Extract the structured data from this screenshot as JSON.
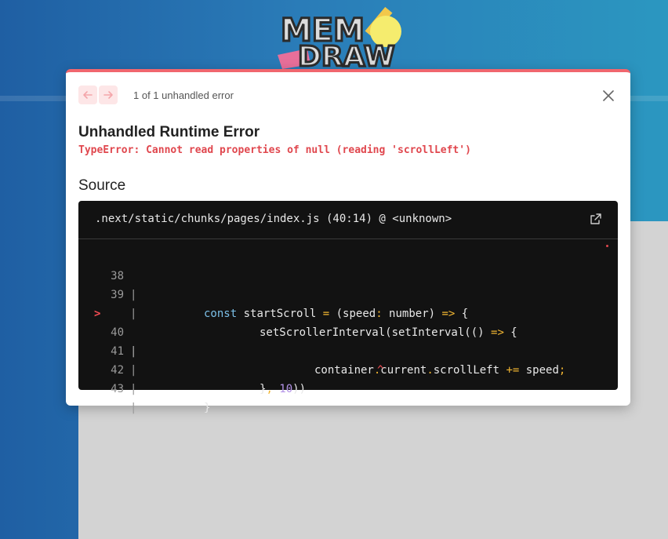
{
  "app": {
    "logo_line1": "MEM",
    "logo_line2": "DRAW"
  },
  "overlay": {
    "counter": "1 of 1 unhandled error",
    "title": "Unhandled Runtime Error",
    "message": "TypeError: Cannot read properties of null (reading 'scrollLeft')",
    "source_heading": "Source",
    "file_path": ".next/static/chunks/pages/index.js (40:14) @ <unknown>"
  },
  "code": {
    "marker": ">",
    "pipe": "|",
    "line_numbers": [
      "38",
      "39",
      "40",
      "",
      "41",
      "42",
      "43"
    ],
    "lines": [
      {
        "t1": "const",
        "t2": " startScroll ",
        "t3": "=",
        "t4": " (speed",
        "t5": ":",
        "t6": " number) ",
        "t7": "=>",
        "t8": " {"
      },
      {
        "t1": "setScrollerInterval(setInterval(() ",
        "t2": "=>",
        "t3": " {"
      },
      {
        "t1": "container",
        "t2": ".",
        "t3": "current",
        "t4": ".",
        "t5": "scrollLeft ",
        "t6": "+=",
        "t7": " speed",
        "t8": ";"
      },
      {
        "t1": "^"
      },
      {
        "t1": "}",
        "t2": ",",
        "t3": " 10",
        "t4": "))"
      },
      {
        "t1": "}"
      },
      {
        "t1": ""
      }
    ]
  },
  "colors": {
    "accent": "#f0666e",
    "error_text": "#e0474e",
    "code_bg": "#121212"
  }
}
